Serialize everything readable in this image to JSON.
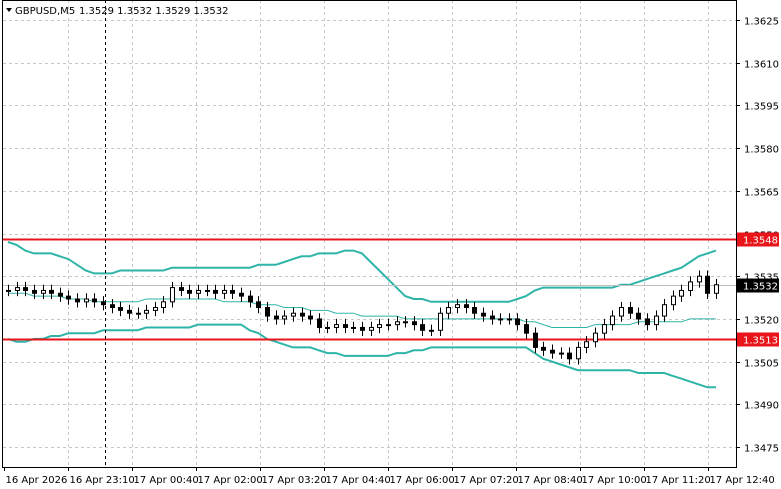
{
  "header": {
    "symbol_label": "GBPUSD,M5",
    "ohlc_text": "1.3529 1.3532 1.3529 1.3532"
  },
  "colors": {
    "background": "#ffffff",
    "grid": "#c8c8c8",
    "frame": "#000000",
    "candle": "#000000",
    "bands": "#2fb5a8",
    "level_lines": "#e8151b",
    "level_label_bg": "#e8151b",
    "price_label_bg": "#000000",
    "price_line": "#c0c0c0"
  },
  "chart_data": {
    "type": "candlestick",
    "symbol": "GBPUSD",
    "timeframe": "M5",
    "ylim": [
      1.3468,
      1.3632
    ],
    "y_ticks": [
      "1.3625",
      "1.3610",
      "1.3595",
      "1.3580",
      "1.3565",
      "1.3550",
      "1.3535",
      "1.3520",
      "1.3505",
      "1.3490",
      "1.3475"
    ],
    "x_ticks": [
      "16 Apr 2026",
      "16 Apr 23:10",
      "17 Apr 00:40",
      "17 Apr 02:00",
      "17 Apr 03:20",
      "17 Apr 04:40",
      "17 Apr 06:00",
      "17 Apr 07:20",
      "17 Apr 08:40",
      "17 Apr 10:00",
      "17 Apr 11:20",
      "17 Apr 12:40"
    ],
    "levels": [
      {
        "label": "1.3548",
        "value": 1.3548
      },
      {
        "label": "1.3513",
        "value": 1.3513
      }
    ],
    "current_price": {
      "label": "1.3532",
      "value": 1.3532
    },
    "grid": true,
    "crosshair_x_label": "16 Apr 23:10",
    "closes": [
      1.353,
      1.3531,
      1.353,
      1.3529,
      1.353,
      1.3529,
      1.3528,
      1.3527,
      1.3526,
      1.3527,
      1.3526,
      1.3525,
      1.3524,
      1.3523,
      1.3522,
      1.3522,
      1.3523,
      1.3524,
      1.3526,
      1.3531,
      1.353,
      1.3529,
      1.353,
      1.353,
      1.3529,
      1.353,
      1.3529,
      1.3528,
      1.3526,
      1.3524,
      1.3521,
      1.352,
      1.3521,
      1.3522,
      1.3521,
      1.352,
      1.3517,
      1.3517,
      1.3518,
      1.3517,
      1.3517,
      1.3516,
      1.3517,
      1.3518,
      1.3518,
      1.3519,
      1.3519,
      1.3518,
      1.3516,
      1.3516,
      1.3522,
      1.3524,
      1.3525,
      1.3524,
      1.3522,
      1.3521,
      1.352,
      1.352,
      1.352,
      1.3518,
      1.3515,
      1.351,
      1.3509,
      1.3508,
      1.3508,
      1.3506,
      1.351,
      1.3512,
      1.3515,
      1.3518,
      1.3521,
      1.3524,
      1.3522,
      1.352,
      1.3518,
      1.3521,
      1.3525,
      1.3528,
      1.353,
      1.3533,
      1.3535,
      1.3529,
      1.3532
    ],
    "band_upper": [
      1.3547,
      1.3546,
      1.3544,
      1.3543,
      1.3543,
      1.3543,
      1.3542,
      1.3541,
      1.3539,
      1.3537,
      1.3536,
      1.3536,
      1.3536,
      1.3537,
      1.3537,
      1.3537,
      1.3537,
      1.3537,
      1.3537,
      1.3538,
      1.3538,
      1.3538,
      1.3538,
      1.3538,
      1.3538,
      1.3538,
      1.3538,
      1.3538,
      1.3538,
      1.3539,
      1.3539,
      1.3539,
      1.354,
      1.3541,
      1.3542,
      1.3542,
      1.3543,
      1.3543,
      1.3543,
      1.3544,
      1.3544,
      1.3543,
      1.354,
      1.3537,
      1.3534,
      1.3531,
      1.3528,
      1.3527,
      1.3527,
      1.3526,
      1.3526,
      1.3526,
      1.3526,
      1.3526,
      1.3526,
      1.3526,
      1.3526,
      1.3526,
      1.3526,
      1.3527,
      1.3528,
      1.353,
      1.3531,
      1.3531,
      1.3531,
      1.3531,
      1.3531,
      1.3531,
      1.3531,
      1.3531,
      1.3531,
      1.3532,
      1.3532,
      1.3533,
      1.3534,
      1.3535,
      1.3536,
      1.3537,
      1.3538,
      1.354,
      1.3542,
      1.3543,
      1.3544
    ],
    "band_middle": [
      1.3529,
      1.3529,
      1.3529,
      1.3528,
      1.3528,
      1.3528,
      1.3528,
      1.3527,
      1.3527,
      1.3527,
      1.3526,
      1.3526,
      1.3526,
      1.3526,
      1.3526,
      1.3526,
      1.3527,
      1.3527,
      1.3527,
      1.3527,
      1.3527,
      1.3527,
      1.3527,
      1.3527,
      1.3527,
      1.3526,
      1.3526,
      1.3526,
      1.3526,
      1.3525,
      1.3525,
      1.3525,
      1.3524,
      1.3524,
      1.3524,
      1.3523,
      1.3523,
      1.3523,
      1.3522,
      1.3522,
      1.3522,
      1.3521,
      1.3521,
      1.3521,
      1.3521,
      1.3521,
      1.352,
      1.352,
      1.352,
      1.352,
      1.352,
      1.352,
      1.352,
      1.352,
      1.352,
      1.352,
      1.352,
      1.352,
      1.352,
      1.352,
      1.3519,
      1.3519,
      1.3518,
      1.3517,
      1.3517,
      1.3517,
      1.3517,
      1.3517,
      1.3518,
      1.3518,
      1.3518,
      1.3518,
      1.3518,
      1.3519,
      1.3519,
      1.3519,
      1.3519,
      1.3519,
      1.3519,
      1.352,
      1.352,
      1.352,
      1.352
    ],
    "band_lower": [
      1.3513,
      1.3512,
      1.3512,
      1.3513,
      1.3513,
      1.3514,
      1.3514,
      1.3515,
      1.3515,
      1.3515,
      1.3515,
      1.3516,
      1.3516,
      1.3516,
      1.3516,
      1.3516,
      1.3517,
      1.3517,
      1.3517,
      1.3517,
      1.3517,
      1.3517,
      1.3518,
      1.3518,
      1.3518,
      1.3518,
      1.3518,
      1.3518,
      1.3516,
      1.3515,
      1.3513,
      1.3512,
      1.3511,
      1.351,
      1.351,
      1.351,
      1.3509,
      1.3508,
      1.3508,
      1.3507,
      1.3507,
      1.3507,
      1.3507,
      1.3507,
      1.3507,
      1.3508,
      1.3508,
      1.3509,
      1.3509,
      1.351,
      1.351,
      1.351,
      1.351,
      1.351,
      1.351,
      1.351,
      1.351,
      1.351,
      1.351,
      1.351,
      1.351,
      1.3508,
      1.3506,
      1.3505,
      1.3504,
      1.3503,
      1.3502,
      1.3502,
      1.3502,
      1.3502,
      1.3502,
      1.3502,
      1.3502,
      1.3501,
      1.3501,
      1.3501,
      1.3501,
      1.35,
      1.3499,
      1.3498,
      1.3497,
      1.3496,
      1.3496
    ]
  }
}
